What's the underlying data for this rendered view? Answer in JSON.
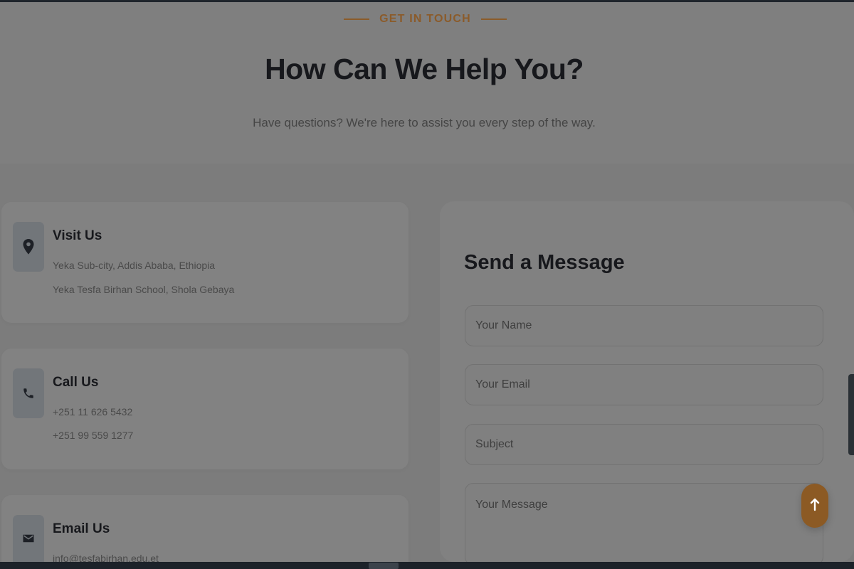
{
  "header": {
    "eyebrow": "GET IN TOUCH",
    "title": "How Can We Help You?",
    "subtitle": "Have questions? We're here to assist you every step of the way."
  },
  "contact_cards": [
    {
      "title": "Visit Us",
      "icon": "location-pin-icon",
      "lines": [
        "Yeka Sub-city, Addis Ababa, Ethiopia",
        "Yeka Tesfa Birhan School, Shola Gebaya"
      ]
    },
    {
      "title": "Call Us",
      "icon": "phone-icon",
      "lines": [
        "+251 11 626 5432",
        "+251 99 559 1277"
      ]
    },
    {
      "title": "Email Us",
      "icon": "envelope-icon",
      "lines": [
        "info@tesfabirhan.edu.et"
      ]
    }
  ],
  "form": {
    "title": "Send a Message",
    "fields": {
      "name_placeholder": "Your Name",
      "email_placeholder": "Your Email",
      "subject_placeholder": "Subject",
      "message_placeholder": "Your Message"
    }
  },
  "floating_action": {
    "icon": "arrow-up-icon"
  },
  "colors": {
    "accent": "#8b5b2a",
    "text_dark": "#17181c",
    "muted": "#454545",
    "overlay": "#7f7f7f"
  }
}
